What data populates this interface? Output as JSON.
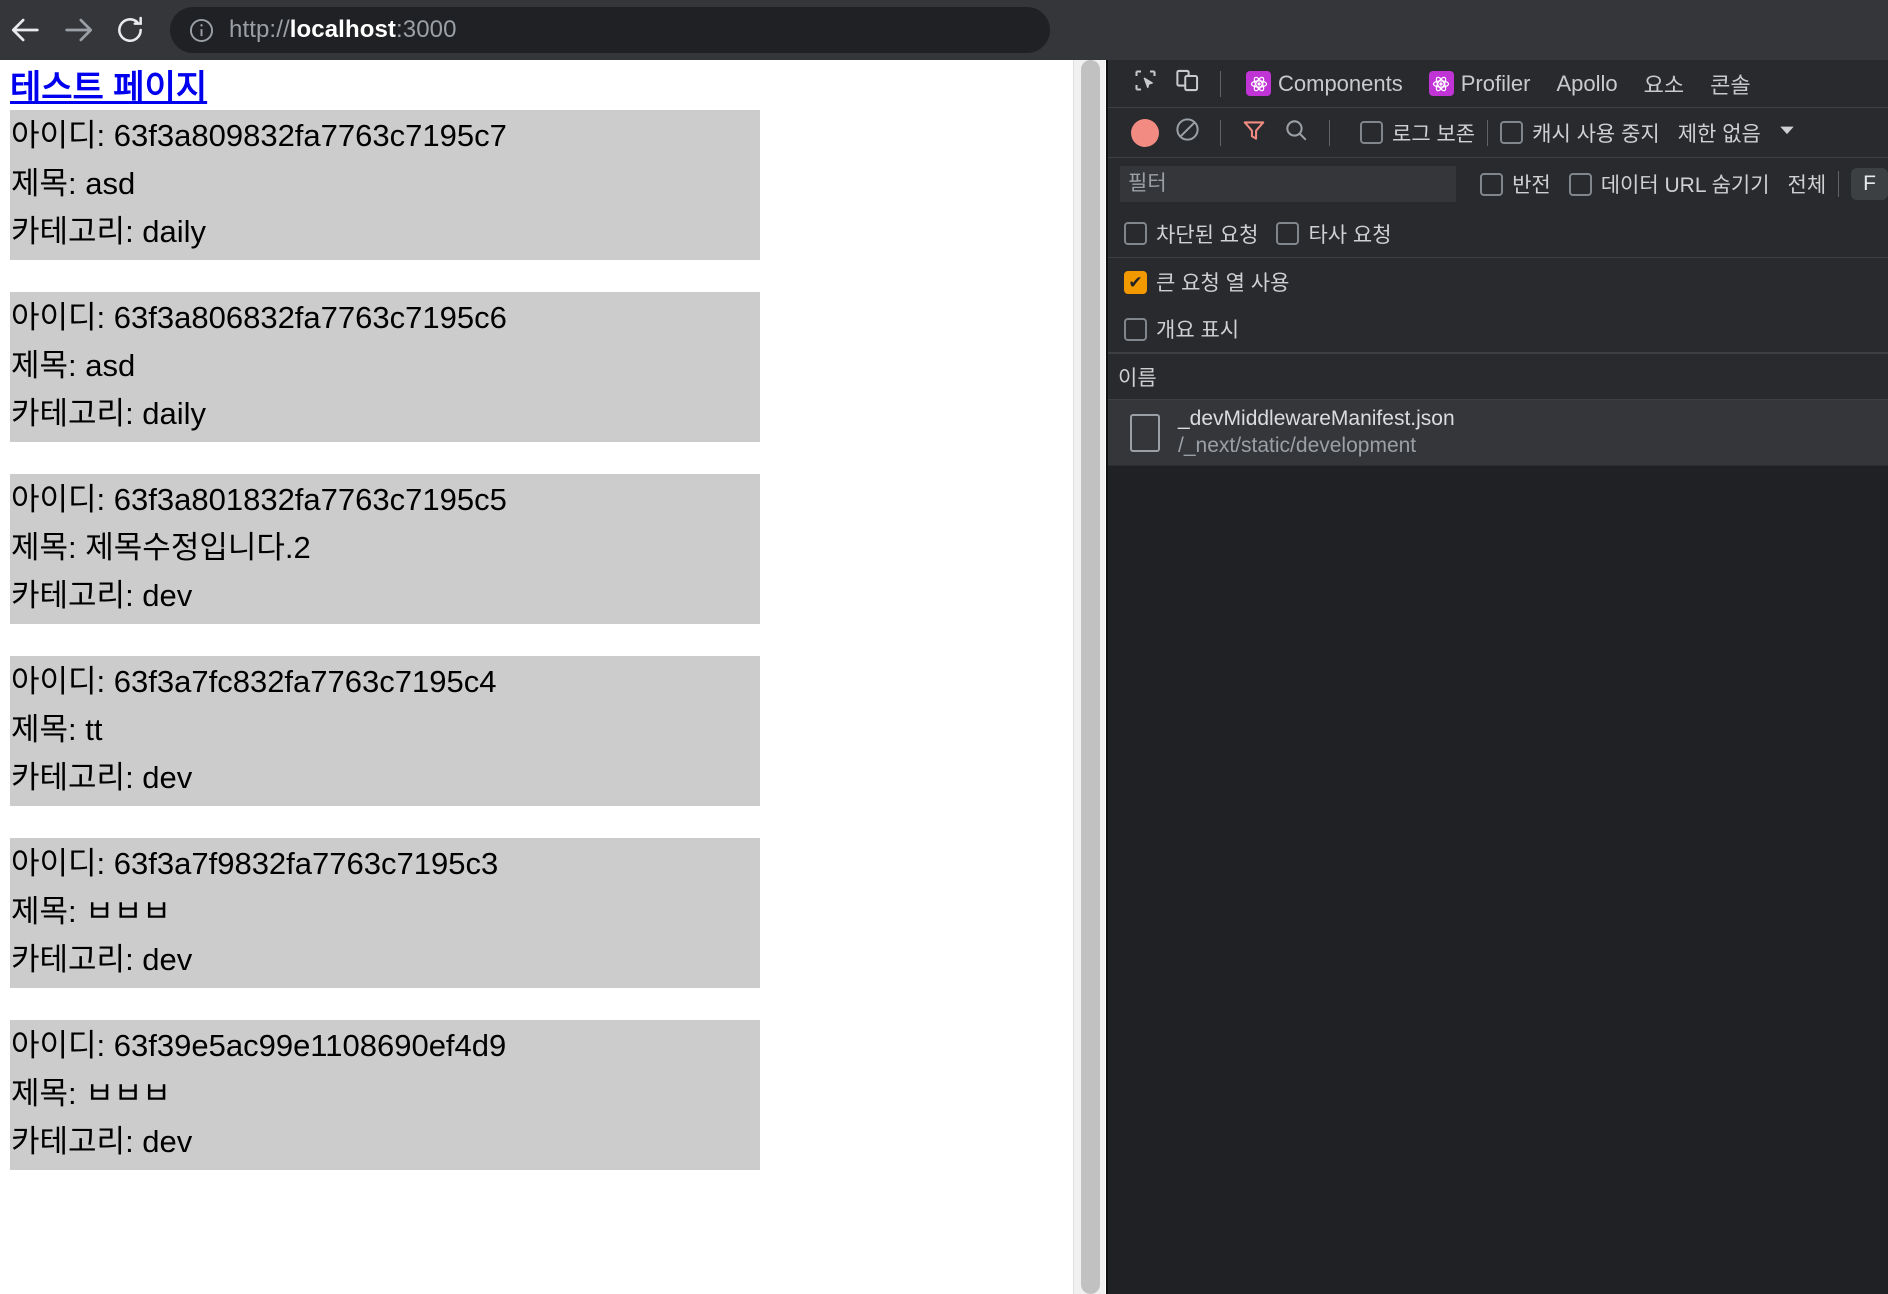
{
  "browser": {
    "back_icon": "arrow-left-icon",
    "forward_icon": "arrow-right-icon",
    "reload_icon": "reload-icon",
    "site_info_icon": "info-circle-icon",
    "url": {
      "scheme": "http://",
      "host": "localhost",
      "port": ":3000",
      "full": "http://localhost:3000"
    }
  },
  "page": {
    "link_label": "테스트 페이지",
    "field_labels": {
      "id": "아이디:",
      "title": "제목:",
      "category": "카테고리:"
    },
    "posts": [
      {
        "id": "63f3a809832fa7763c7195c7",
        "title": "asd",
        "category": "daily"
      },
      {
        "id": "63f3a806832fa7763c7195c6",
        "title": "asd",
        "category": "daily"
      },
      {
        "id": "63f3a801832fa7763c7195c5",
        "title": "제목수정입니다.2",
        "category": "dev"
      },
      {
        "id": "63f3a7fc832fa7763c7195c4",
        "title": "tt",
        "category": "dev"
      },
      {
        "id": "63f3a7f9832fa7763c7195c3",
        "title": "ㅂㅂㅂ",
        "category": "dev"
      },
      {
        "id": "63f39e5ac99e1108690ef4d9",
        "title": "ㅂㅂㅂ",
        "category": "dev"
      }
    ]
  },
  "devtools": {
    "tabbar": {
      "inspect_icon": "inspect-element-icon",
      "device_icon": "device-toolbar-icon",
      "tabs": [
        {
          "label": "Components",
          "icon": "react-atom-icon",
          "active": false
        },
        {
          "label": "Profiler",
          "icon": "react-atom-icon",
          "active": false
        },
        {
          "label": "Apollo",
          "icon": null,
          "active": false
        },
        {
          "label": "요소",
          "icon": null,
          "active": false
        },
        {
          "label": "콘솔",
          "icon": null,
          "active": false
        }
      ]
    },
    "network_toolbar": {
      "record_icon": "record-circle-icon",
      "clear_icon": "clear-no-entry-icon",
      "filter_icon": "funnel-filter-icon",
      "search_icon": "search-magnifier-icon",
      "preserve_log_label": "로그 보존",
      "preserve_log_checked": false,
      "disable_cache_label": "캐시 사용 중지",
      "disable_cache_checked": false,
      "throttling_label": "제한 없음",
      "throttling_caret": "chevron-down-icon"
    },
    "filter_bar": {
      "filter_placeholder": "필터",
      "filter_value": "",
      "invert_label": "반전",
      "invert_checked": false,
      "hide_data_urls_label": "데이터 URL 숨기기",
      "hide_data_urls_checked": false,
      "all_label": "전체",
      "fetch_xhr_label": "F"
    },
    "filter_row_2": {
      "blocked_requests_label": "차단된 요청",
      "blocked_requests_checked": false,
      "third_party_label": "타사 요청",
      "third_party_checked": false
    },
    "filter_row_3": {
      "big_request_rows_label": "큰 요청 열 사용",
      "big_request_rows_checked": true
    },
    "filter_row_4": {
      "show_overview_label": "개요 표시",
      "show_overview_checked": false
    },
    "table": {
      "column_name": "이름",
      "rows": [
        {
          "name": "_devMiddlewareManifest.json",
          "path": "/_next/static/development",
          "icon": "json-file-icon"
        }
      ]
    }
  },
  "colors": {
    "browser_chrome": "#35363a",
    "omnibox_bg": "#202124",
    "link": "#0000ee",
    "card_bg": "#cccccc",
    "devtools_bg": "#202124",
    "devtools_panel": "#292a2d",
    "accent_checked": "#f29900",
    "react_badge": "#c034d6",
    "record_red": "#f28b82",
    "filter_active": "#f28b82"
  }
}
